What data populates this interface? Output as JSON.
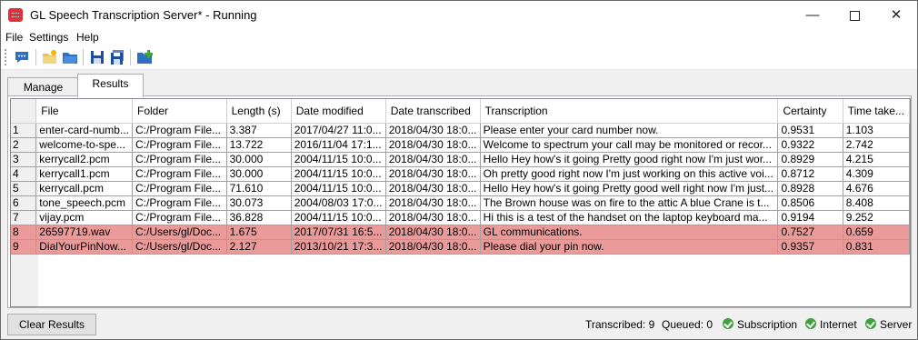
{
  "window": {
    "title": "GL Speech Transcription Server* - Running",
    "icon": "speech-bubble-icon",
    "minimize_glyph": "—",
    "close_glyph": "✕"
  },
  "menu": [
    "File",
    "Settings",
    "Help"
  ],
  "toolbar": {
    "icons": [
      "chat-icon",
      "new-folder-icon",
      "open-folder-icon",
      "save-icon",
      "save-all-icon",
      "add-folder-icon"
    ]
  },
  "tabs": [
    {
      "label": "Manage",
      "active": false
    },
    {
      "label": "Results",
      "active": true
    }
  ],
  "table": {
    "columns": [
      "File",
      "Folder",
      "Length (s)",
      "Date modified",
      "Date transcribed",
      "Transcription",
      "Certainty",
      "Time take..."
    ],
    "rows": [
      {
        "n": "1",
        "file": "enter-card-numb...",
        "folder": "C:/Program File...",
        "length": "3.387",
        "modified": "2017/04/27 11:0...",
        "transcribed": "2018/04/30 18:0...",
        "transcription": "Please enter your card number now.",
        "certainty": "0.9531",
        "time": "1.103",
        "highlight": false
      },
      {
        "n": "2",
        "file": "welcome-to-spe...",
        "folder": "C:/Program File...",
        "length": "13.722",
        "modified": "2016/11/04 17:1...",
        "transcribed": "2018/04/30 18:0...",
        "transcription": "Welcome to spectrum your call may be monitored or recor...",
        "certainty": "0.9322",
        "time": "2.742",
        "highlight": false
      },
      {
        "n": "3",
        "file": "kerrycall2.pcm",
        "folder": "C:/Program File...",
        "length": "30.000",
        "modified": "2004/11/15 10:0...",
        "transcribed": "2018/04/30 18:0...",
        "transcription": "Hello Hey how's it going Pretty good right now I'm just wor...",
        "certainty": "0.8929",
        "time": "4.215",
        "highlight": false
      },
      {
        "n": "4",
        "file": "kerrycall1.pcm",
        "folder": "C:/Program File...",
        "length": "30.000",
        "modified": "2004/11/15 10:0...",
        "transcribed": "2018/04/30 18:0...",
        "transcription": "Oh pretty good right now I'm just working on this active voi...",
        "certainty": "0.8712",
        "time": "4.309",
        "highlight": false
      },
      {
        "n": "5",
        "file": "kerrycall.pcm",
        "folder": "C:/Program File...",
        "length": "71.610",
        "modified": "2004/11/15 10:0...",
        "transcribed": "2018/04/30 18:0...",
        "transcription": "Hello Hey how's it going Pretty good well right now I'm just...",
        "certainty": "0.8928",
        "time": "4.676",
        "highlight": false
      },
      {
        "n": "6",
        "file": "tone_speech.pcm",
        "folder": "C:/Program File...",
        "length": "30.073",
        "modified": "2004/08/03 17:0...",
        "transcribed": "2018/04/30 18:0...",
        "transcription": "The Brown house was on fire to the attic A blue Crane is t...",
        "certainty": "0.8506",
        "time": "8.408",
        "highlight": false
      },
      {
        "n": "7",
        "file": "vijay.pcm",
        "folder": "C:/Program File...",
        "length": "36.828",
        "modified": "2004/11/15 10:0...",
        "transcribed": "2018/04/30 18:0...",
        "transcription": "Hi this is a test of the handset on the laptop keyboard ma...",
        "certainty": "0.9194",
        "time": "9.252",
        "highlight": false
      },
      {
        "n": "8",
        "file": "26597719.wav",
        "folder": "C:/Users/gl/Doc...",
        "length": "1.675",
        "modified": "2017/07/31 16:5...",
        "transcribed": "2018/04/30 18:0...",
        "transcription": "GL communications.",
        "certainty": "0.7527",
        "time": "0.659",
        "highlight": true
      },
      {
        "n": "9",
        "file": "DialYourPinNow...",
        "folder": "C:/Users/gl/Doc...",
        "length": "2.127",
        "modified": "2013/10/21 17:3...",
        "transcribed": "2018/04/30 18:0...",
        "transcription": "Please dial your pin now.",
        "certainty": "0.9357",
        "time": "0.831",
        "highlight": true
      }
    ],
    "highlight_color": "#e99a99"
  },
  "footer": {
    "clear_label": "Clear Results",
    "transcribed": "Transcribed: 9",
    "queued": "Queued: 0",
    "indicators": [
      "Subscription",
      "Internet",
      "Server"
    ],
    "ok_color": "#3fa23f"
  }
}
